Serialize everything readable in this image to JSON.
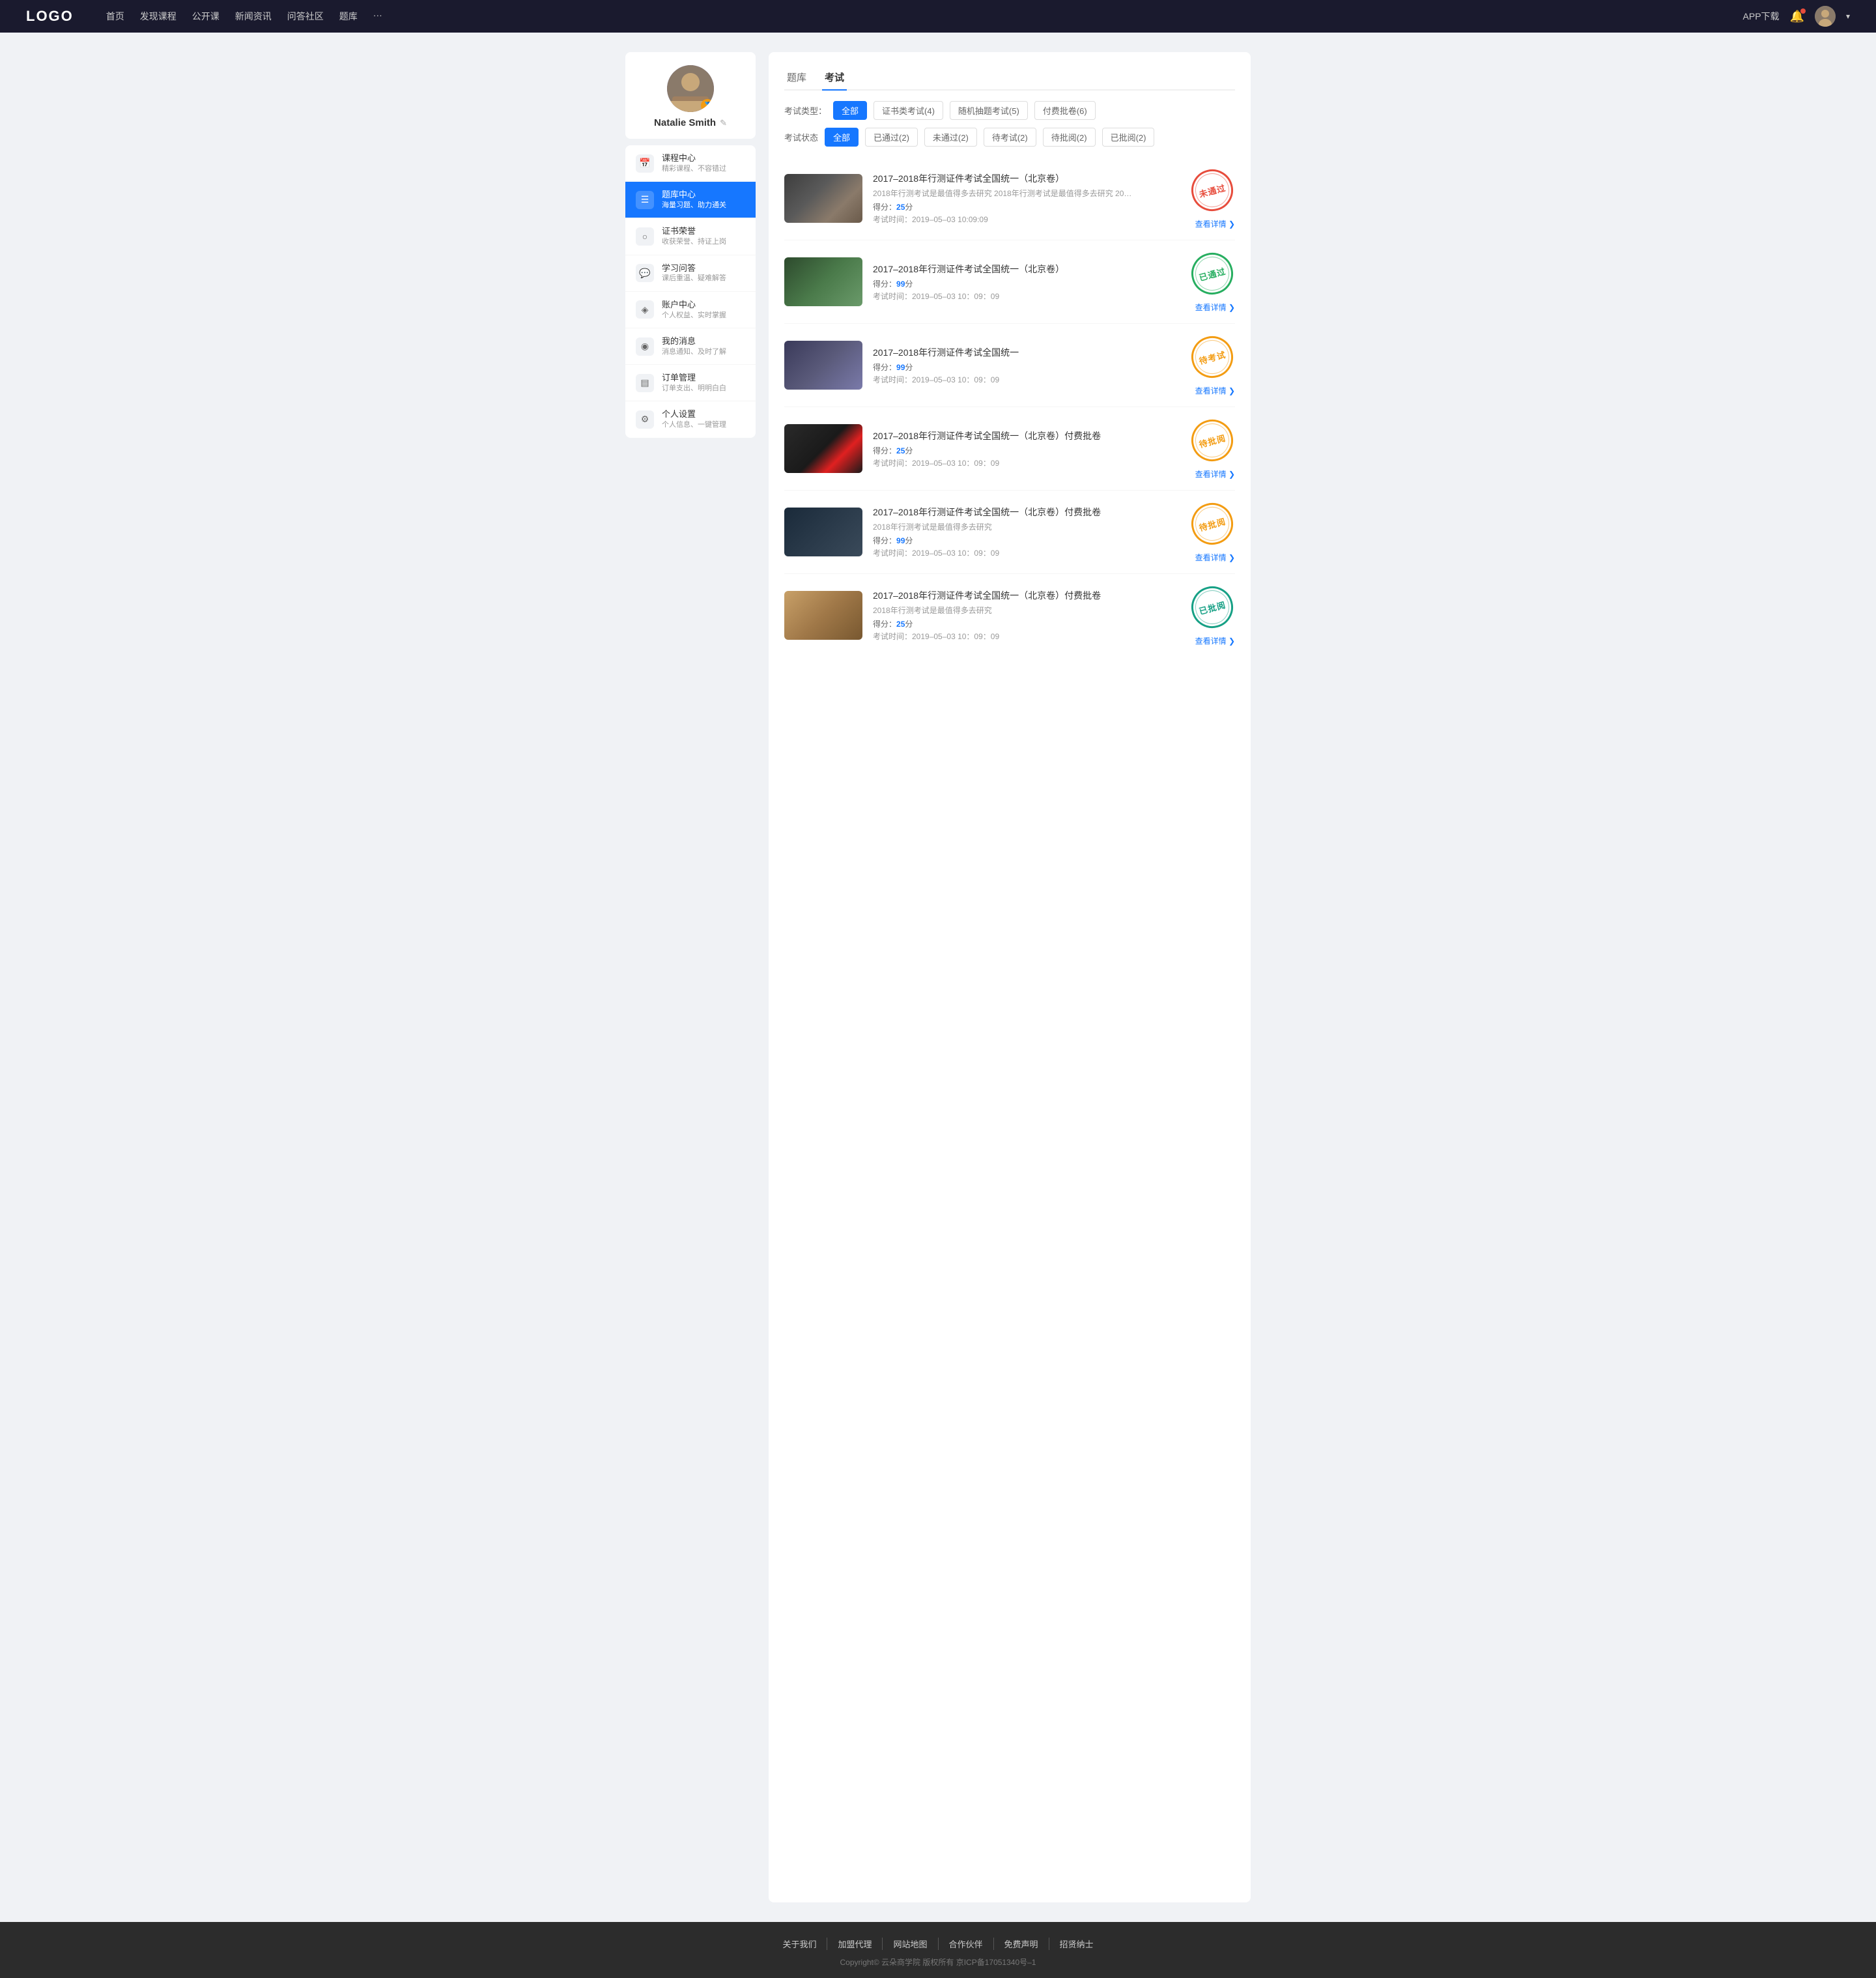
{
  "navbar": {
    "logo": "LOGO",
    "links": [
      {
        "label": "首页",
        "id": "home"
      },
      {
        "label": "发现课程",
        "id": "discover"
      },
      {
        "label": "公开课",
        "id": "opencourse"
      },
      {
        "label": "新闻资讯",
        "id": "news"
      },
      {
        "label": "问答社区",
        "id": "qa"
      },
      {
        "label": "题库",
        "id": "qbank"
      },
      {
        "label": "···",
        "id": "more"
      }
    ],
    "app_download": "APP下载",
    "chevron": "▾"
  },
  "sidebar": {
    "profile": {
      "name": "Natalie Smith",
      "edit_icon": "✎"
    },
    "menu_items": [
      {
        "id": "course-center",
        "icon": "📅",
        "title": "课程中心",
        "subtitle": "精彩课程、不容错过",
        "active": false
      },
      {
        "id": "question-bank",
        "icon": "📋",
        "title": "题库中心",
        "subtitle": "海量习题、助力通关",
        "active": true
      },
      {
        "id": "certificate",
        "icon": "🏆",
        "title": "证书荣誉",
        "subtitle": "收获荣誉、持证上岗",
        "active": false
      },
      {
        "id": "study-qa",
        "icon": "💬",
        "title": "学习问答",
        "subtitle": "课后重温、疑难解答",
        "active": false
      },
      {
        "id": "account",
        "icon": "💎",
        "title": "账户中心",
        "subtitle": "个人权益、实时掌握",
        "active": false
      },
      {
        "id": "messages",
        "icon": "💬",
        "title": "我的消息",
        "subtitle": "消息通知、及时了解",
        "active": false
      },
      {
        "id": "orders",
        "icon": "📄",
        "title": "订单管理",
        "subtitle": "订单支出、明明白白",
        "active": false
      },
      {
        "id": "settings",
        "icon": "⚙",
        "title": "个人设置",
        "subtitle": "个人信息、一键管理",
        "active": false
      }
    ]
  },
  "content": {
    "top_tabs": [
      {
        "id": "question-bank-tab",
        "label": "题库",
        "active": false
      },
      {
        "id": "exam-tab",
        "label": "考试",
        "active": true
      }
    ],
    "type_filters": {
      "label": "考试类型：",
      "options": [
        {
          "id": "all",
          "label": "全部",
          "active": true
        },
        {
          "id": "certificate",
          "label": "证书类考试(4)",
          "active": false
        },
        {
          "id": "random",
          "label": "随机抽题考试(5)",
          "active": false
        },
        {
          "id": "paid",
          "label": "付费批卷(6)",
          "active": false
        }
      ]
    },
    "status_filters": {
      "label": "考试状态",
      "options": [
        {
          "id": "all",
          "label": "全部",
          "active": true
        },
        {
          "id": "passed",
          "label": "已通过(2)",
          "active": false
        },
        {
          "id": "failed",
          "label": "未通过(2)",
          "active": false
        },
        {
          "id": "pending",
          "label": "待考试(2)",
          "active": false
        },
        {
          "id": "wait-review",
          "label": "待批阅(2)",
          "active": false
        },
        {
          "id": "reviewed",
          "label": "已批阅(2)",
          "active": false
        }
      ]
    },
    "exams": [
      {
        "id": "exam-1",
        "title": "2017–2018年行测证件考试全国统一（北京卷）",
        "desc": "2018年行测考试是最值得多去研究 2018年行测考试是最值得多去研究 2018年行...",
        "score_label": "得分：",
        "score": "25",
        "score_unit": "分",
        "time_label": "考试时间：",
        "time": "2019–05–03  10:09:09",
        "status": "未通过",
        "status_type": "red",
        "thumb_class": "thumb-laptop",
        "detail_label": "查看详情"
      },
      {
        "id": "exam-2",
        "title": "2017–2018年行测证件考试全国统一（北京卷）",
        "desc": "",
        "score_label": "得分：",
        "score": "99",
        "score_unit": "分",
        "time_label": "考试时间：",
        "time": "2019–05–03  10：09：09",
        "status": "已通过",
        "status_type": "green",
        "thumb_class": "thumb-woman",
        "detail_label": "查看详情"
      },
      {
        "id": "exam-3",
        "title": "2017–2018年行测证件考试全国统一",
        "desc": "",
        "score_label": "得分：",
        "score": "99",
        "score_unit": "分",
        "time_label": "考试时间：",
        "time": "2019–05–03  10：09：09",
        "status": "待考试",
        "status_type": "orange",
        "thumb_class": "thumb-man",
        "detail_label": "查看详情"
      },
      {
        "id": "exam-4",
        "title": "2017–2018年行测证件考试全国统一（北京卷）付费批卷",
        "desc": "",
        "score_label": "得分：",
        "score": "25",
        "score_unit": "分",
        "time_label": "考试时间：",
        "time": "2019–05–03  10：09：09",
        "status": "待批阅",
        "status_type": "orange",
        "thumb_class": "thumb-camera",
        "detail_label": "查看详情"
      },
      {
        "id": "exam-5",
        "title": "2017–2018年行测证件考试全国统一（北京卷）付费批卷",
        "desc": "2018年行测考试是最值得多去研究",
        "score_label": "得分：",
        "score": "99",
        "score_unit": "分",
        "time_label": "考试时间：",
        "time": "2019–05–03  10：09：09",
        "status": "待批阅",
        "status_type": "orange",
        "thumb_class": "thumb-building1",
        "detail_label": "查看详情"
      },
      {
        "id": "exam-6",
        "title": "2017–2018年行测证件考试全国统一（北京卷）付费批卷",
        "desc": "2018年行测考试是最值得多去研究",
        "score_label": "得分：",
        "score": "25",
        "score_unit": "分",
        "time_label": "考试时间：",
        "time": "2019–05–03  10：09：09",
        "status": "已批阅",
        "status_type": "teal",
        "thumb_class": "thumb-building2",
        "detail_label": "查看详情"
      }
    ]
  },
  "footer": {
    "links": [
      {
        "label": "关于我们",
        "id": "about"
      },
      {
        "label": "加盟代理",
        "id": "agent"
      },
      {
        "label": "网站地图",
        "id": "sitemap"
      },
      {
        "label": "合作伙伴",
        "id": "partners"
      },
      {
        "label": "免费声明",
        "id": "disclaimer"
      },
      {
        "label": "招贤纳士",
        "id": "jobs"
      }
    ],
    "copyright": "Copyright© 云朵商学院  版权所有    京ICP备17051340号–1"
  }
}
